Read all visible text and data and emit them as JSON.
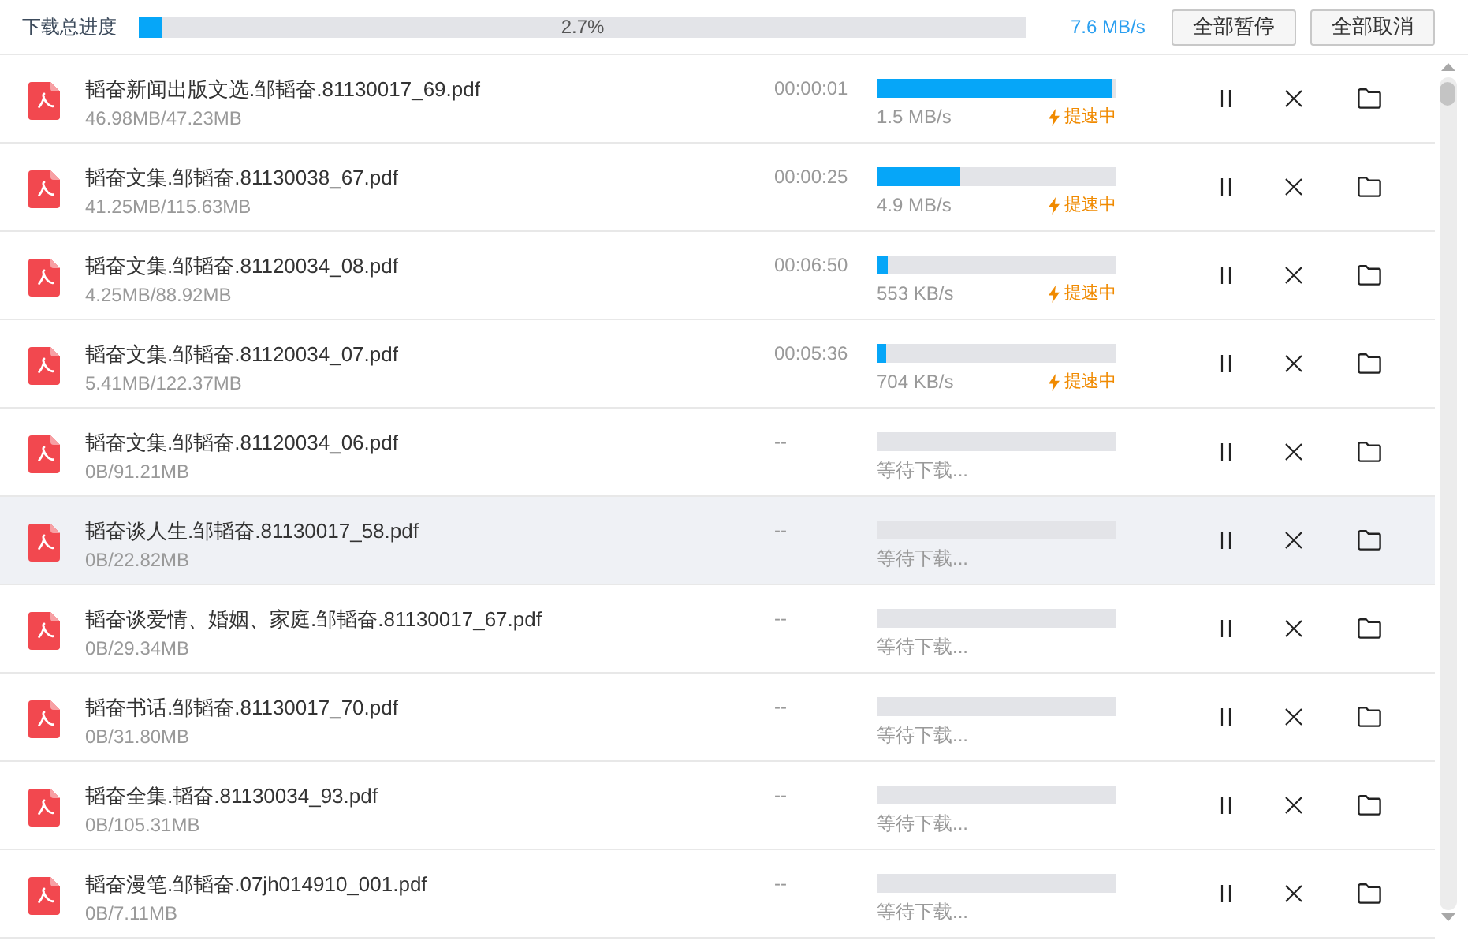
{
  "header": {
    "label": "下载总进度",
    "level": 0.027,
    "percent": "2.7%",
    "speed": "7.6 MB/s",
    "buttons": [
      "全部暂停",
      "全部取消"
    ]
  },
  "downloads": [
    {
      "name": "韬奋新闻出版文选.邹韬奋.81130017_69.pdf",
      "size": "46.98MB/47.23MB",
      "time": "00:00:01",
      "level": 0.98,
      "status": "1.5 MB/s",
      "boost": "提速中",
      "hovered": false
    },
    {
      "name": "韬奋文集.邹韬奋.81130038_67.pdf",
      "size": "41.25MB/115.63MB",
      "time": "00:00:25",
      "level": 0.35,
      "status": "4.9 MB/s",
      "boost": "提速中",
      "hovered": false
    },
    {
      "name": "韬奋文集.邹韬奋.81120034_08.pdf",
      "size": "4.25MB/88.92MB",
      "time": "00:06:50",
      "level": 0.046,
      "status": "553 KB/s",
      "boost": "提速中",
      "hovered": false
    },
    {
      "name": "韬奋文集.邹韬奋.81120034_07.pdf",
      "size": "5.41MB/122.37MB",
      "time": "00:05:36",
      "level": 0.04,
      "status": "704 KB/s",
      "boost": "提速中",
      "hovered": false
    },
    {
      "name": "韬奋文集.邹韬奋.81120034_06.pdf",
      "size": "0B/91.21MB",
      "time": "--",
      "status": "等待下载...",
      "hovered": false
    },
    {
      "name": "韬奋谈人生.邹韬奋.81130017_58.pdf",
      "size": "0B/22.82MB",
      "time": "--",
      "status": "等待下载...",
      "hovered": true
    },
    {
      "name": "韬奋谈爱情、婚姻、家庭.邹韬奋.81130017_67.pdf",
      "size": "0B/29.34MB",
      "time": "--",
      "status": "等待下载...",
      "hovered": false
    },
    {
      "name": "韬奋书话.邹韬奋.81130017_70.pdf",
      "size": "0B/31.80MB",
      "time": "--",
      "status": "等待下载...",
      "hovered": false
    },
    {
      "name": "韬奋全集.韬奋.81130034_93.pdf",
      "size": "0B/105.31MB",
      "time": "--",
      "status": "等待下载...",
      "hovered": false
    },
    {
      "name": "韬奋漫笔.邹韬奋.07jh014910_001.pdf",
      "size": "0B/7.11MB",
      "time": "--",
      "status": "等待下载...",
      "hovered": false
    }
  ]
}
